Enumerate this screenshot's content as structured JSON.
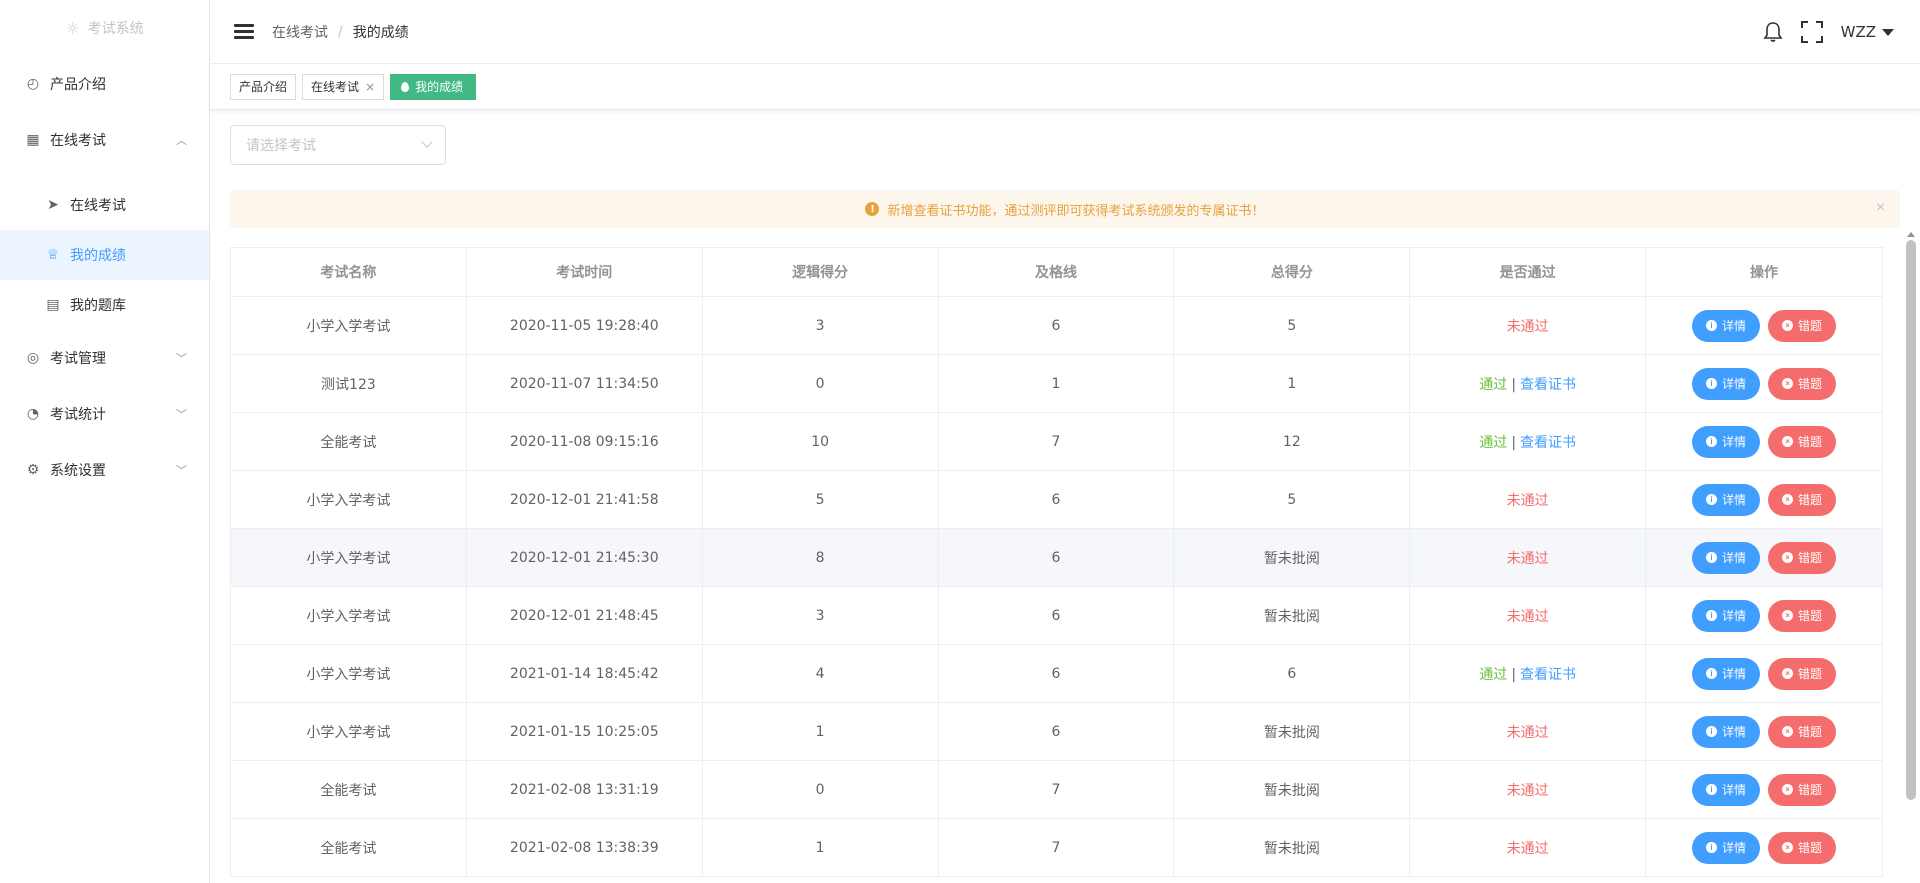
{
  "app": {
    "logo_text": "考试系统"
  },
  "sidebar": {
    "items": [
      {
        "label": "产品介绍"
      },
      {
        "label": "在线考试"
      },
      {
        "label": "在线考试"
      },
      {
        "label": "我的成绩"
      },
      {
        "label": "我的题库"
      },
      {
        "label": "考试管理"
      },
      {
        "label": "考试统计"
      },
      {
        "label": "系统设置"
      }
    ]
  },
  "header": {
    "breadcrumb": [
      "在线考试",
      "我的成绩"
    ],
    "breadcrumb_sep": "/",
    "user": "WZZ"
  },
  "tags": [
    {
      "label": "产品介绍"
    },
    {
      "label": "在线考试",
      "close": "×"
    },
    {
      "label": "我的成绩"
    }
  ],
  "filter": {
    "placeholder": "请选择考试"
  },
  "alert": {
    "text": "新增查看证书功能，通过测评即可获得考试系统颁发的专属证书！",
    "close": "×"
  },
  "table": {
    "columns": [
      "考试名称",
      "考试时间",
      "逻辑得分",
      "及格线",
      "总得分",
      "是否通过",
      "操作"
    ],
    "rows": [
      {
        "name": "小学入学考试",
        "time": "2020-11-05 19:28:40",
        "logic": "3",
        "pass_line": "6",
        "total": "5",
        "status": "未通过",
        "passed": false
      },
      {
        "name": "测试123",
        "time": "2020-11-07 11:34:50",
        "logic": "0",
        "pass_line": "1",
        "total": "1",
        "status": "通过",
        "passed": true
      },
      {
        "name": "全能考试",
        "time": "2020-11-08 09:15:16",
        "logic": "10",
        "pass_line": "7",
        "total": "12",
        "status": "通过",
        "passed": true
      },
      {
        "name": "小学入学考试",
        "time": "2020-12-01 21:41:58",
        "logic": "5",
        "pass_line": "6",
        "total": "5",
        "status": "未通过",
        "passed": false
      },
      {
        "name": "小学入学考试",
        "time": "2020-12-01 21:45:30",
        "logic": "8",
        "pass_line": "6",
        "total": "暂未批阅",
        "status": "未通过",
        "passed": false
      },
      {
        "name": "小学入学考试",
        "time": "2020-12-01 21:48:45",
        "logic": "3",
        "pass_line": "6",
        "total": "暂未批阅",
        "status": "未通过",
        "passed": false
      },
      {
        "name": "小学入学考试",
        "time": "2021-01-14 18:45:42",
        "logic": "4",
        "pass_line": "6",
        "total": "6",
        "status": "通过",
        "passed": true
      },
      {
        "name": "小学入学考试",
        "time": "2021-01-15 10:25:05",
        "logic": "1",
        "pass_line": "6",
        "total": "暂未批阅",
        "status": "未通过",
        "passed": false
      },
      {
        "name": "全能考试",
        "time": "2021-02-08 13:31:19",
        "logic": "0",
        "pass_line": "7",
        "total": "暂未批阅",
        "status": "未通过",
        "passed": false
      },
      {
        "name": "全能考试",
        "time": "2021-02-08 13:38:39",
        "logic": "1",
        "pass_line": "7",
        "total": "暂未批阅",
        "status": "未通过",
        "passed": false
      }
    ],
    "cert_link": "查看证书",
    "cert_sep": "|",
    "detail_button": "详情",
    "wrong_button": "错题",
    "hover_row": 4
  },
  "colors": {
    "accent": "#409eff",
    "danger": "#f56c6c",
    "success": "#67c23a",
    "active_tag": "#42b983",
    "warning": "#e6a23c"
  },
  "icons": {
    "logo": "sun-icon",
    "product": "dashboard-icon",
    "online_exam": "grid-icon",
    "online_exam_sub": "paper-plane-icon",
    "my_scores": "trophy-icon",
    "my_bank": "book-icon",
    "exam_manage": "lifebuoy-icon",
    "exam_stats": "pie-chart-icon",
    "settings": "gear-icon"
  }
}
